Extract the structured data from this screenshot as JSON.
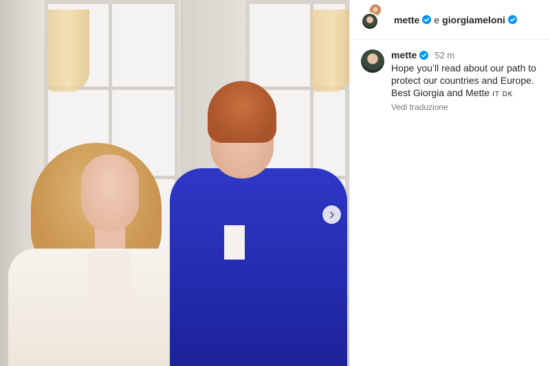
{
  "header": {
    "user1": "mette",
    "conjunction": "e",
    "user2": "giorgiameloni"
  },
  "comment": {
    "username": "mette",
    "time": "52 m",
    "text": "Hope you’ll read about our path to protect our countries and Europe. Best Giorgia and Mette",
    "flags": "IT DK",
    "translate_label": "Vedi traduzione"
  },
  "colors": {
    "verified": "#0095f6",
    "muted": "#737373",
    "text": "#262626"
  },
  "icons": {
    "next": "chevron-right-icon",
    "verified": "verified-badge-icon"
  }
}
